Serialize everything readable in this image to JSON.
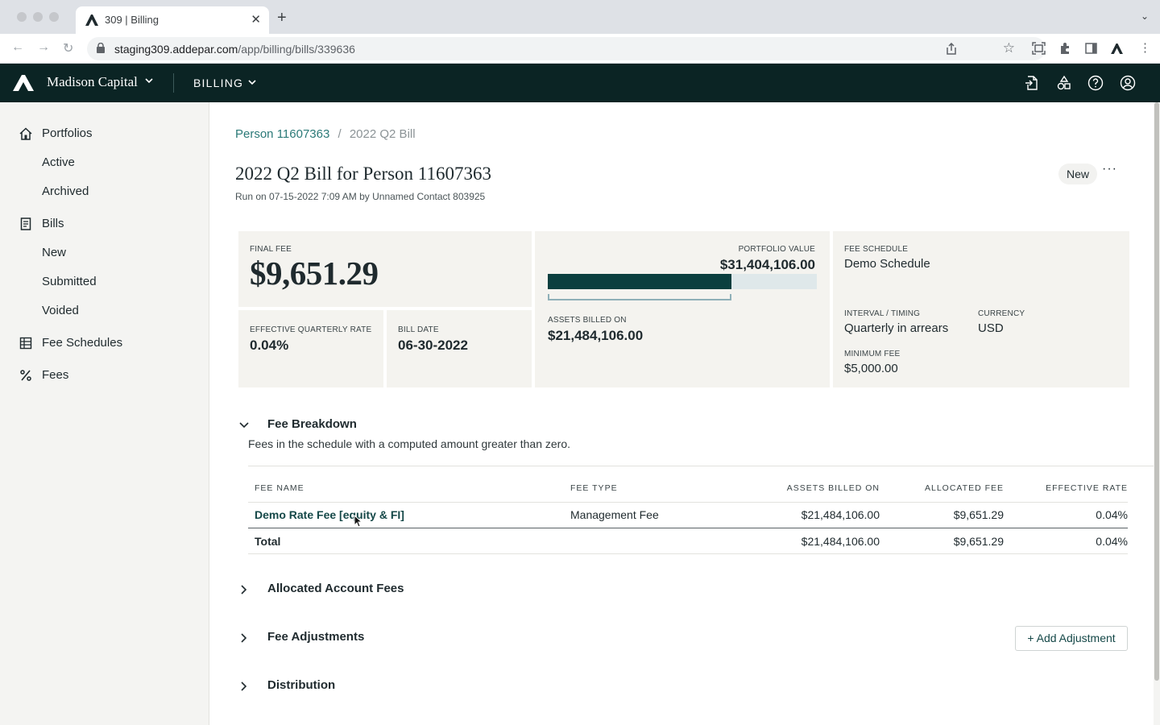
{
  "browser": {
    "tab_title": "309 | Billing",
    "url_host": "staging309.addepar.com",
    "url_path": "/app/billing/bills/339636"
  },
  "header": {
    "org_name": "Madison Capital",
    "module": "BILLING"
  },
  "sidebar": {
    "items": [
      {
        "label": "Portfolios",
        "icon": "home-icon"
      },
      {
        "label": "Active"
      },
      {
        "label": "Archived"
      },
      {
        "label": "Bills",
        "icon": "document-icon"
      },
      {
        "label": "New"
      },
      {
        "label": "Submitted"
      },
      {
        "label": "Voided"
      },
      {
        "label": "Fee Schedules",
        "icon": "grid-icon"
      },
      {
        "label": "Fees",
        "icon": "percent-icon"
      }
    ]
  },
  "breadcrumb": {
    "parent": "Person 11607363",
    "separator": "/",
    "current": "2022 Q2 Bill"
  },
  "page": {
    "title": "2022 Q2 Bill for Person 11607363",
    "run_info": "Run on 07-15-2022 7:09 AM by Unnamed Contact 803925",
    "status": "New",
    "more": "···"
  },
  "summary": {
    "final_fee_label": "FINAL FEE",
    "final_fee": "$9,651.29",
    "eff_rate_label": "EFFECTIVE QUARTERLY RATE",
    "eff_rate": "0.04%",
    "bill_date_label": "BILL DATE",
    "bill_date": "06-30-2022",
    "portfolio_value_label": "PORTFOLIO VALUE",
    "portfolio_value": "$31,404,106.00",
    "assets_billed_label": "ASSETS BILLED ON",
    "assets_billed": "$21,484,106.00",
    "billed_fraction": 0.684,
    "fee_schedule_label": "FEE SCHEDULE",
    "fee_schedule": "Demo Schedule",
    "interval_label": "INTERVAL / TIMING",
    "interval": "Quarterly in arrears",
    "currency_label": "CURRENCY",
    "currency": "USD",
    "min_fee_label": "MINIMUM FEE",
    "min_fee": "$5,000.00"
  },
  "fee_breakdown": {
    "title": "Fee Breakdown",
    "description": "Fees in the schedule with a computed amount greater than zero.",
    "columns": [
      "FEE NAME",
      "FEE TYPE",
      "ASSETS BILLED ON",
      "ALLOCATED FEE",
      "EFFECTIVE RATE"
    ],
    "rows": [
      {
        "name": "Demo Rate Fee [equity & FI]",
        "type": "Management Fee",
        "assets": "$21,484,106.00",
        "fee": "$9,651.29",
        "rate": "0.04%"
      }
    ],
    "total": {
      "label": "Total",
      "assets": "$21,484,106.00",
      "fee": "$9,651.29",
      "rate": "0.04%"
    }
  },
  "sections": {
    "allocated": "Allocated Account Fees",
    "adjustments": "Fee Adjustments",
    "add_adjustment": "+ Add Adjustment",
    "distribution": "Distribution"
  },
  "colors": {
    "header_bg": "#0b2424",
    "accent": "#154848",
    "link": "#2b7a78",
    "bar_fill": "#0b3f3f"
  }
}
